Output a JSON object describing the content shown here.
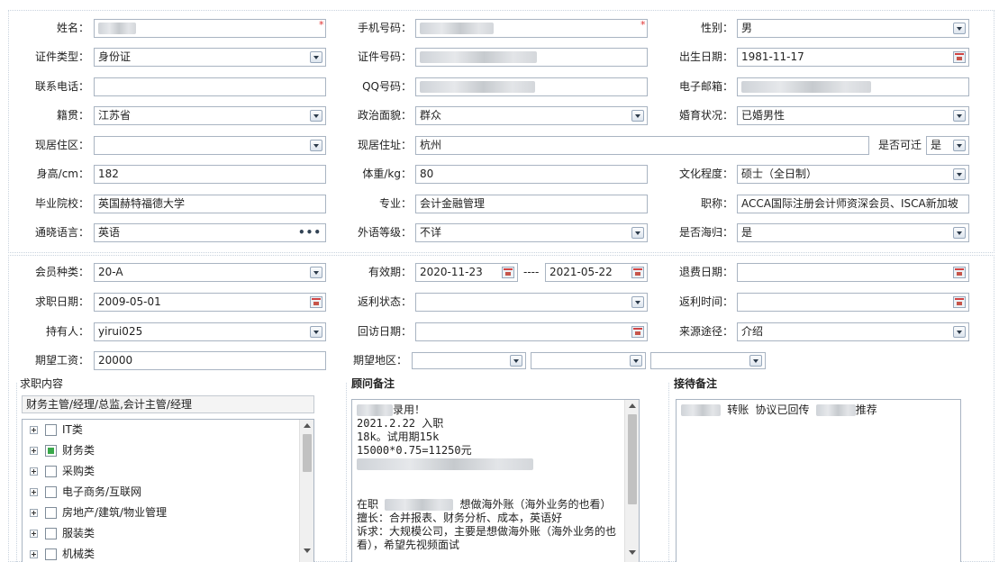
{
  "basic": {
    "name_label": "姓名：",
    "phone_label": "手机号码：",
    "gender_label": "性别：",
    "gender_value": "男",
    "idtype_label": "证件类型：",
    "idtype_value": "身份证",
    "idno_label": "证件号码：",
    "birth_label": "出生日期：",
    "birth_value": "1981-11-17",
    "contact_label": "联系电话：",
    "qq_label": "QQ号码：",
    "email_label": "电子邮箱：",
    "origin_label": "籍贯：",
    "origin_value": "江苏省",
    "political_label": "政治面貌：",
    "political_value": "群众",
    "marital_label": "婚育状况：",
    "marital_value": "已婚男性",
    "area_label": "现居住区：",
    "address_label": "现居住址：",
    "address_value": "杭州",
    "relocate_label": "是否可迁",
    "relocate_value": "是",
    "height_label": "身高/cm：",
    "height_value": "182",
    "weight_label": "体重/kg：",
    "weight_value": "80",
    "edu_label": "文化程度：",
    "edu_value": "硕士（全日制）",
    "school_label": "毕业院校：",
    "school_value": "英国赫特福德大学",
    "major_label": "专业：",
    "major_value": "会计金融管理",
    "title_label": "职称：",
    "title_value": "ACCA国际注册会计师资深会员、ISCA新加坡",
    "lang_label": "通晓语言：",
    "lang_value": "英语",
    "langlevel_label": "外语等级：",
    "langlevel_value": "不详",
    "overseas_label": "是否海归：",
    "overseas_value": "是"
  },
  "member": {
    "type_label": "会员种类：",
    "type_value": "20-A",
    "valid_label": "有效期：",
    "valid_from": "2020-11-23",
    "valid_sep": "----",
    "valid_to": "2021-05-22",
    "refund_date_label": "退费日期：",
    "job_date_label": "求职日期：",
    "job_date_value": "2009-05-01",
    "rebate_status_label": "返利状态：",
    "rebate_time_label": "返利时间：",
    "holder_label": "持有人：",
    "holder_value": "yirui025",
    "revisit_label": "回访日期：",
    "source_label": "来源途径：",
    "source_value": "介绍",
    "salary_label": "期望工资：",
    "salary_value": "20000",
    "region_label": "期望地区："
  },
  "panels": {
    "job_title": "求职内容",
    "job_summary": "财务主管/经理/总监,会计主管/经理",
    "tree": [
      {
        "label": "IT类",
        "checked": false
      },
      {
        "label": "财务类",
        "checked": true
      },
      {
        "label": "采购类",
        "checked": false
      },
      {
        "label": "电子商务/互联网",
        "checked": false
      },
      {
        "label": "房地产/建筑/物业管理",
        "checked": false
      },
      {
        "label": "服装类",
        "checked": false
      },
      {
        "label": "机械类",
        "checked": false
      }
    ],
    "advisor_title": "顾问备注",
    "advisor_lines": [
      "录用！",
      "2021.2.22 入职",
      "18k。试用期15k",
      "15000*0.75=11250元",
      "",
      "",
      "",
      "在职  想做海外账（海外业务的也看）",
      "擅长：合并报表、财务分析、成本，英语好",
      "诉求：大规模公司，主要是想做海外账（海外业务的也看），希望先视频面试"
    ],
    "reception_title": "接待备注",
    "reception_text_a": "转账 协议已回传",
    "reception_text_b": "推荐"
  }
}
